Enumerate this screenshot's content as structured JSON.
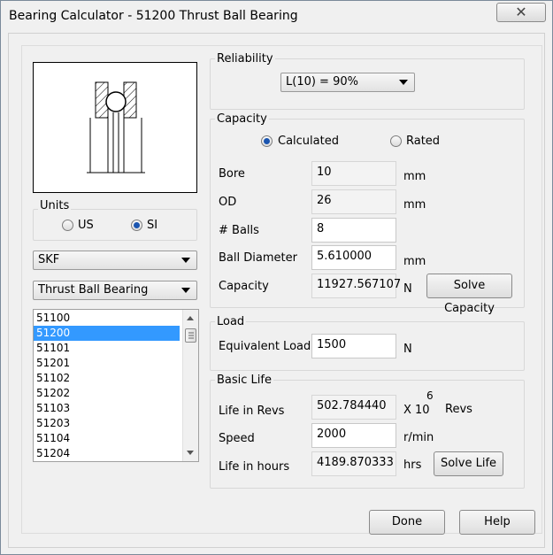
{
  "window": {
    "title": "Bearing Calculator - 51200 Thrust Ball Bearing",
    "close_glyph": "✕"
  },
  "units": {
    "label": "Units",
    "options": [
      "US",
      "SI"
    ],
    "selected": "SI"
  },
  "manufacturer": {
    "value": "SKF"
  },
  "bearing_type": {
    "value": "Thrust Ball Bearing"
  },
  "bearing_list": {
    "items": [
      "51100",
      "51200",
      "51101",
      "51201",
      "51102",
      "51202",
      "51103",
      "51203",
      "51104",
      "51204"
    ],
    "selected": "51200"
  },
  "reliability": {
    "label": "Reliability",
    "value": "L(10) = 90%"
  },
  "capacity": {
    "label": "Capacity",
    "mode_options": [
      "Calculated",
      "Rated"
    ],
    "mode_selected": "Calculated",
    "bore": {
      "label": "Bore",
      "value": "10",
      "unit": "mm"
    },
    "od": {
      "label": "OD",
      "value": "26",
      "unit": "mm"
    },
    "balls": {
      "label": "# Balls",
      "value": "8"
    },
    "ball_diameter": {
      "label": "Ball Diameter",
      "value": "5.610000",
      "unit": "mm"
    },
    "capacity_value": {
      "label": "Capacity",
      "value": "11927.567107",
      "unit": "N"
    },
    "solve_label": "Solve Capacity"
  },
  "load": {
    "label": "Load",
    "equivalent": {
      "label": "Equivalent Load",
      "value": "1500",
      "unit": "N"
    }
  },
  "basic_life": {
    "label": "Basic Life",
    "revs": {
      "label": "Life in Revs",
      "value": "502.784440",
      "unit_prefix": "X 10",
      "exponent": "6",
      "unit": "Revs"
    },
    "speed": {
      "label": "Speed",
      "value": "2000",
      "unit": "r/min"
    },
    "hours": {
      "label": "Life in hours",
      "value": "4189.870333",
      "unit": "hrs"
    },
    "solve_label": "Solve Life"
  },
  "footer": {
    "done_label": "Done",
    "help_label": "Help"
  }
}
